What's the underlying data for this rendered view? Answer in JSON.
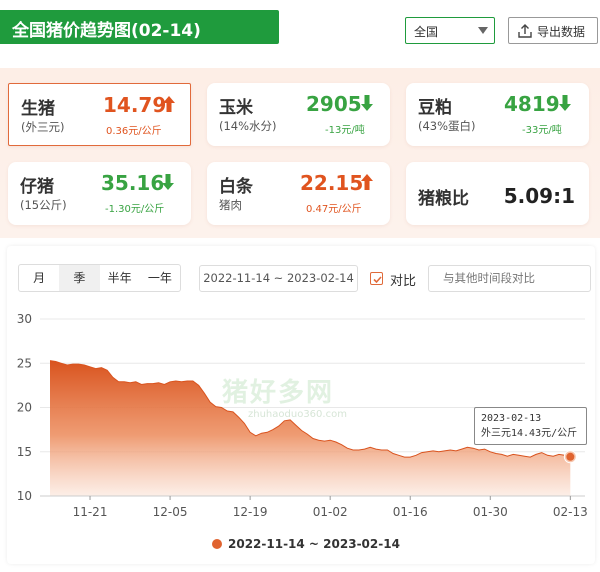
{
  "header": {
    "title": "全国猪价趋势图(02-14)",
    "region_select": "全国",
    "export_label": "导出数据"
  },
  "cards": [
    {
      "name": "生猪",
      "sub": "(外三元)",
      "price": "14.79",
      "change": "0.36元/公斤",
      "trend": "up"
    },
    {
      "name": "玉米",
      "sub": "(14%水分)",
      "price": "2905",
      "change": "-13元/吨",
      "trend": "down"
    },
    {
      "name": "豆粕",
      "sub": "(43%蛋白)",
      "price": "4819",
      "change": "-33元/吨",
      "trend": "down"
    },
    {
      "name": "仔猪",
      "sub": "(15公斤)",
      "price": "35.16",
      "change": "-1.30元/公斤",
      "trend": "down"
    },
    {
      "name": "白条",
      "sub": "猪肉",
      "price": "22.15",
      "change": "0.47元/公斤",
      "trend": "up"
    },
    {
      "name": "猪粮比",
      "ratio": "5.09:1"
    }
  ],
  "controls": {
    "tabs": [
      "月",
      "季",
      "半年",
      "一年"
    ],
    "active_tab": "季",
    "date_range": "2022-11-14 ~ 2023-02-14",
    "compare_label": "对比",
    "compare_placeholder": "与其他时间段对比"
  },
  "tooltip": {
    "date": "2023-02-13",
    "value_text": "外三元14.43元/公斤"
  },
  "watermark": {
    "text": "猪好多网",
    "sub": "zhuhaoduo360.com"
  },
  "chart_data": {
    "type": "area",
    "ylim": [
      10,
      30
    ],
    "yticks": [
      10,
      15,
      20,
      25,
      30
    ],
    "x_start": "2022-11-14",
    "xticks": [
      {
        "date": "2022-11-21",
        "label": "11-21"
      },
      {
        "date": "2022-12-05",
        "label": "12-05"
      },
      {
        "date": "2022-12-19",
        "label": "12-19"
      },
      {
        "date": "2023-01-02",
        "label": "01-02"
      },
      {
        "date": "2023-01-16",
        "label": "01-16"
      },
      {
        "date": "2023-01-30",
        "label": "01-30"
      },
      {
        "date": "2023-02-13",
        "label": "02-13"
      }
    ],
    "series": [
      {
        "name": "2022-11-14 ~ 2023-02-14",
        "color": "#e0632f",
        "points": [
          [
            "2022-11-14",
            25.3
          ],
          [
            "2022-11-15",
            25.2
          ],
          [
            "2022-11-16",
            25.0
          ],
          [
            "2022-11-17",
            24.8
          ],
          [
            "2022-11-18",
            24.9
          ],
          [
            "2022-11-19",
            24.9
          ],
          [
            "2022-11-20",
            24.8
          ],
          [
            "2022-11-21",
            24.6
          ],
          [
            "2022-11-22",
            24.4
          ],
          [
            "2022-11-23",
            24.5
          ],
          [
            "2022-11-24",
            24.2
          ],
          [
            "2022-11-25",
            23.4
          ],
          [
            "2022-11-26",
            22.9
          ],
          [
            "2022-11-27",
            22.9
          ],
          [
            "2022-11-28",
            22.8
          ],
          [
            "2022-11-29",
            22.9
          ],
          [
            "2022-11-30",
            22.6
          ],
          [
            "2022-12-01",
            22.7
          ],
          [
            "2022-12-02",
            22.7
          ],
          [
            "2022-12-03",
            22.8
          ],
          [
            "2022-12-04",
            22.6
          ],
          [
            "2022-12-05",
            22.9
          ],
          [
            "2022-12-06",
            23.0
          ],
          [
            "2022-12-07",
            22.9
          ],
          [
            "2022-12-08",
            23.0
          ],
          [
            "2022-12-09",
            23.0
          ],
          [
            "2022-12-10",
            22.5
          ],
          [
            "2022-12-11",
            21.6
          ],
          [
            "2022-12-12",
            20.6
          ],
          [
            "2022-12-13",
            20.1
          ],
          [
            "2022-12-14",
            20.0
          ],
          [
            "2022-12-15",
            19.6
          ],
          [
            "2022-12-16",
            19.5
          ],
          [
            "2022-12-17",
            18.9
          ],
          [
            "2022-12-18",
            18.2
          ],
          [
            "2022-12-19",
            17.2
          ],
          [
            "2022-12-20",
            16.8
          ],
          [
            "2022-12-21",
            17.1
          ],
          [
            "2022-12-22",
            17.2
          ],
          [
            "2022-12-23",
            17.5
          ],
          [
            "2022-12-24",
            17.9
          ],
          [
            "2022-12-25",
            18.5
          ],
          [
            "2022-12-26",
            18.6
          ],
          [
            "2022-12-27",
            18.0
          ],
          [
            "2022-12-28",
            17.4
          ],
          [
            "2022-12-29",
            17.0
          ],
          [
            "2022-12-30",
            16.5
          ],
          [
            "2022-12-31",
            16.3
          ],
          [
            "2023-01-01",
            16.2
          ],
          [
            "2023-01-02",
            16.3
          ],
          [
            "2023-01-03",
            16.1
          ],
          [
            "2023-01-04",
            15.8
          ],
          [
            "2023-01-05",
            15.4
          ],
          [
            "2023-01-06",
            15.2
          ],
          [
            "2023-01-07",
            15.2
          ],
          [
            "2023-01-08",
            15.3
          ],
          [
            "2023-01-09",
            15.5
          ],
          [
            "2023-01-10",
            15.3
          ],
          [
            "2023-01-11",
            15.2
          ],
          [
            "2023-01-12",
            15.2
          ],
          [
            "2023-01-13",
            14.8
          ],
          [
            "2023-01-14",
            14.6
          ],
          [
            "2023-01-15",
            14.4
          ],
          [
            "2023-01-16",
            14.4
          ],
          [
            "2023-01-17",
            14.6
          ],
          [
            "2023-01-18",
            14.9
          ],
          [
            "2023-01-19",
            15.0
          ],
          [
            "2023-01-20",
            15.1
          ],
          [
            "2023-01-21",
            15.0
          ],
          [
            "2023-01-22",
            15.1
          ],
          [
            "2023-01-23",
            15.2
          ],
          [
            "2023-01-24",
            15.1
          ],
          [
            "2023-01-25",
            15.3
          ],
          [
            "2023-01-26",
            15.5
          ],
          [
            "2023-01-27",
            15.4
          ],
          [
            "2023-01-28",
            15.2
          ],
          [
            "2023-01-29",
            15.3
          ],
          [
            "2023-01-30",
            15.0
          ],
          [
            "2023-01-31",
            14.8
          ],
          [
            "2023-02-01",
            14.7
          ],
          [
            "2023-02-02",
            14.5
          ],
          [
            "2023-02-03",
            14.7
          ],
          [
            "2023-02-04",
            14.6
          ],
          [
            "2023-02-05",
            14.5
          ],
          [
            "2023-02-06",
            14.4
          ],
          [
            "2023-02-07",
            14.7
          ],
          [
            "2023-02-08",
            14.9
          ],
          [
            "2023-02-09",
            14.6
          ],
          [
            "2023-02-10",
            14.5
          ],
          [
            "2023-02-11",
            14.7
          ],
          [
            "2023-02-12",
            14.6
          ],
          [
            "2023-02-13",
            14.43
          ]
        ]
      }
    ],
    "highlight": {
      "date": "2023-02-13",
      "value": 14.43
    },
    "grid": "horizontal",
    "legend_position": "bottom-center"
  }
}
